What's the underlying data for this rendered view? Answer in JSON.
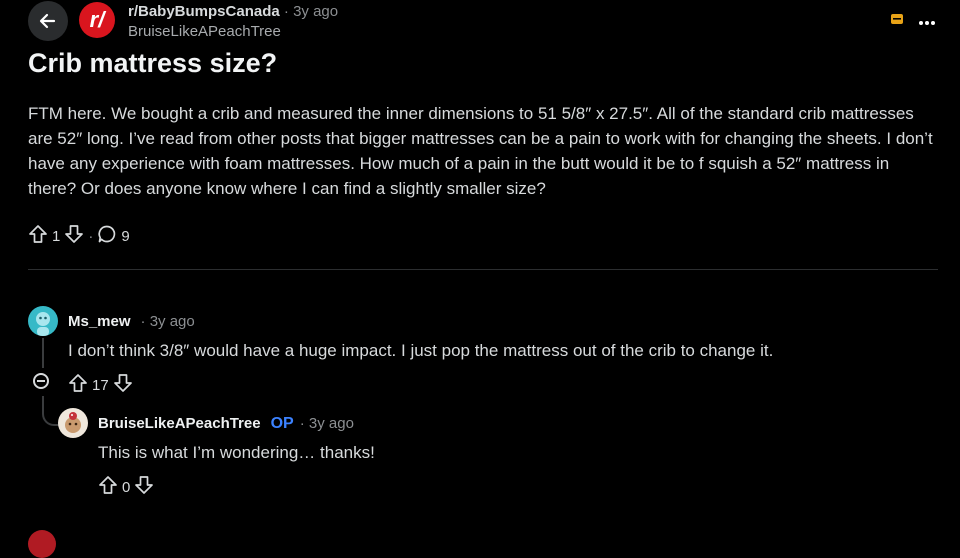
{
  "header": {
    "subreddit": "r/BabyBumpsCanada",
    "separator": "·",
    "post_time": "3y ago",
    "author": "BruiseLikeAPeachTree",
    "sub_icon_text": "r/"
  },
  "post": {
    "title": "Crib mattress size?",
    "body": "FTM here. We bought a crib and measured the inner dimensions to 51 5/8″ x 27.5″. All of the standard crib mattresses are 52″ long. I’ve read from other posts that bigger mattresses can be a pain to work with for changing the sheets. I don’t have any experience with foam mattresses. How much of a pain in the butt would it be to f squish a 52″ mattress in there? Or does anyone know where I can find a slightly smaller size?",
    "votes": "1",
    "separator": "·",
    "comments": "9"
  },
  "comments": [
    {
      "username": "Ms_mew",
      "time": "· 3y ago",
      "text": "I don’t think 3/8″ would have a huge impact. I just pop the mattress out of the crib to change it.",
      "votes": "17"
    },
    {
      "username": "BruiseLikeAPeachTree",
      "op_badge": "OP",
      "time": "· 3y ago",
      "text": "This is what I’m wondering… thanks!",
      "votes": "0"
    }
  ],
  "colors": {
    "background": "#000000",
    "subreddit_icon": "#d9151e",
    "op_badge": "#3c82ff",
    "award_icon": "#e8a317"
  },
  "icons": [
    "back-arrow-icon",
    "subreddit-icon",
    "award-icon",
    "more-options-icon",
    "upvote-icon",
    "downvote-icon",
    "comment-icon",
    "collapse-icon"
  ]
}
